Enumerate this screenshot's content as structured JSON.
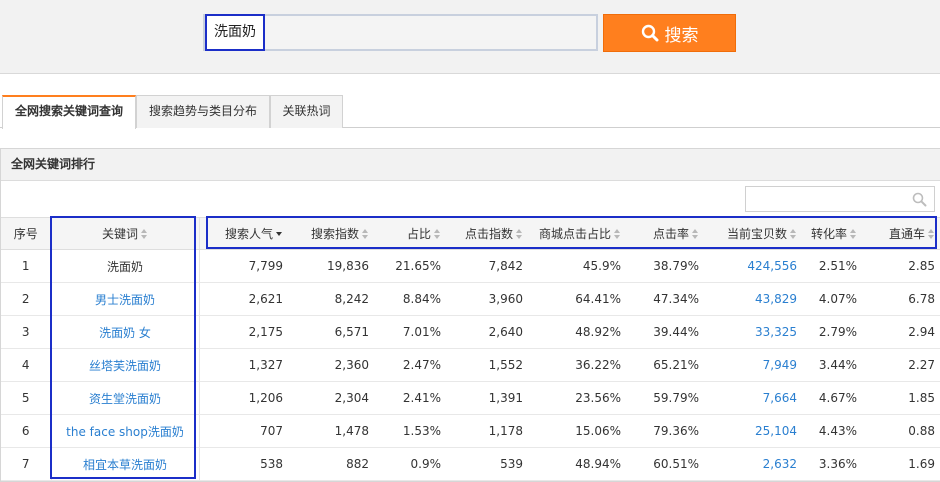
{
  "search": {
    "value": "洗面奶",
    "button_label": "搜索"
  },
  "tabs": [
    {
      "label": "全网搜索关键词查询"
    },
    {
      "label": "搜索趋势与类目分布"
    },
    {
      "label": "关联热词"
    }
  ],
  "panel": {
    "title": "全网关键词排行",
    "filter_value": ""
  },
  "table": {
    "headers": [
      "序号",
      "关键词",
      "搜索人气",
      "搜索指数",
      "占比",
      "点击指数",
      "商城点击占比",
      "点击率",
      "当前宝贝数",
      "转化率",
      "直通车"
    ],
    "rows": [
      [
        "1",
        "洗面奶",
        "7,799",
        "19,836",
        "21.65%",
        "7,842",
        "45.9%",
        "38.79%",
        "424,556",
        "2.51%",
        "2.85"
      ],
      [
        "2",
        "男士洗面奶",
        "2,621",
        "8,242",
        "8.84%",
        "3,960",
        "64.41%",
        "47.34%",
        "43,829",
        "4.07%",
        "6.78"
      ],
      [
        "3",
        "洗面奶 女",
        "2,175",
        "6,571",
        "7.01%",
        "2,640",
        "48.92%",
        "39.44%",
        "33,325",
        "2.79%",
        "2.94"
      ],
      [
        "4",
        "丝塔芙洗面奶",
        "1,327",
        "2,360",
        "2.47%",
        "1,552",
        "36.22%",
        "65.21%",
        "7,949",
        "3.44%",
        "2.27"
      ],
      [
        "5",
        "资生堂洗面奶",
        "1,206",
        "2,304",
        "2.41%",
        "1,391",
        "23.56%",
        "59.79%",
        "7,664",
        "4.67%",
        "1.85"
      ],
      [
        "6",
        "the face shop洗面奶",
        "707",
        "1,478",
        "1.53%",
        "1,178",
        "15.06%",
        "79.36%",
        "25,104",
        "4.43%",
        "0.88"
      ],
      [
        "7",
        "相宜本草洗面奶",
        "538",
        "882",
        "0.9%",
        "539",
        "48.94%",
        "60.51%",
        "2,632",
        "3.36%",
        "1.69"
      ]
    ]
  },
  "colors": {
    "accent": "#ff7f1e",
    "link": "#2a7fd0",
    "highlight": "#1b2ec8"
  }
}
